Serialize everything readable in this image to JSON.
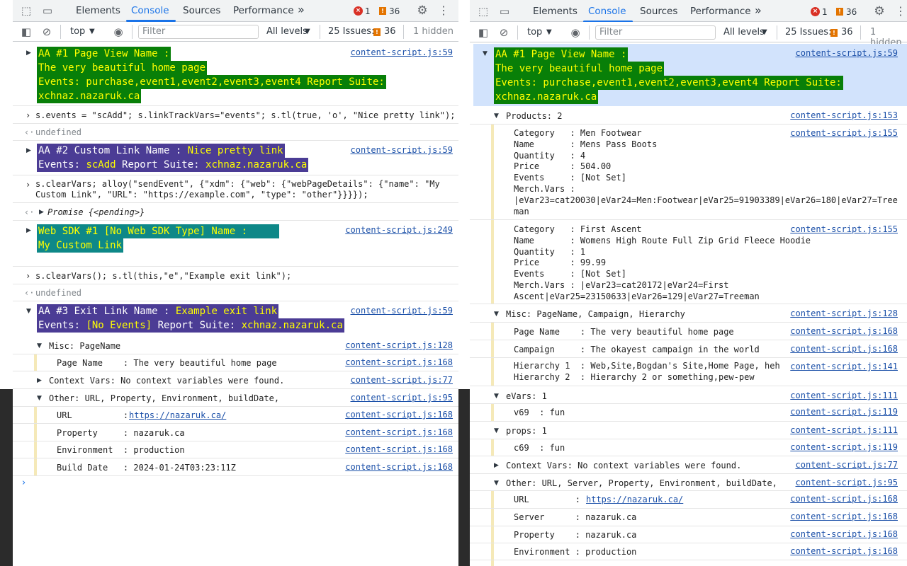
{
  "tabs": {
    "elements": "Elements",
    "console": "Console",
    "sources": "Sources",
    "performance": "Performance",
    "more": "»"
  },
  "status": {
    "errors": "1",
    "warnings": "36"
  },
  "toolbar": {
    "context": "top",
    "filter_placeholder": "Filter",
    "levels": "All levels",
    "issues_label": "25 Issues:",
    "issues_count": "36",
    "hidden": "1 hidden"
  },
  "left": {
    "aa1": {
      "l1": "AA #1 Page View Name :",
      "l2": "The very beautiful home page",
      "l3": "Events: purchase,event1,event2,event3,event4 Report Suite:",
      "l4": "xchnaz.nazaruk.ca",
      "src": "content-script.js:59"
    },
    "cmd1": "s.events = \"scAdd\"; s.linkTrackVars=\"events\"; s.tl(true, 'o', \"Nice pretty link\");",
    "undef1": "undefined",
    "aa2": {
      "l1a": "AA #2 Custom Link Name : ",
      "l1b": "Nice pretty link",
      "l2a": "Events: ",
      "l2b": "scAdd",
      "l2c": " Report Suite: ",
      "l2d": "xchnaz.nazaruk.ca",
      "src": "content-script.js:59"
    },
    "cmd2a": "s.clearVars; alloy(\"sendEvent\", {\"xdm\": {\"web\": {\"webPageDetails\": {\"name\": \"My",
    "cmd2b": "Custom Link\", \"URL\": \"https://example.com\", \"type\": \"other\"}}}});",
    "promise": "Promise {<pending>}",
    "sdk": {
      "l1": "Web SDK #1 [No Web SDK Type] Name :",
      "l2": "My Custom Link",
      "src": "content-script.js:249"
    },
    "cmd3": "s.clearVars(); s.tl(this,\"e\",\"Example exit link\");",
    "undef2": "undefined",
    "aa3": {
      "l1a": "AA #3 Exit Link Name : ",
      "l1b": "Example exit link",
      "l2a": "Events: ",
      "l2b": "[No Events]",
      "l2c": " Report Suite: ",
      "l2d": "xchnaz.nazaruk.ca",
      "src": "content-script.js:59"
    },
    "misc": {
      "title": "Misc: PageName",
      "src": "content-script.js:128",
      "row": "Page Name    : The very beautiful home page",
      "row_src": "content-script.js:168"
    },
    "ctx": {
      "title": "Context Vars: No context variables were found.",
      "src": "content-script.js:77"
    },
    "other": {
      "title": "Other: URL, Property, Environment, buildDate,",
      "src": "content-script.js:95",
      "url_label": "URL          : ",
      "url": "https://nazaruk.ca/",
      "property": "Property     : nazaruk.ca",
      "environment": "Environment  : production",
      "build": "Build Date   : 2024-01-24T03:23:11Z",
      "row_src": "content-script.js:168"
    },
    "prompt": "›"
  },
  "right": {
    "aa1": {
      "l1": "AA #1 Page View Name :",
      "l2": "The very beautiful home page",
      "l3": "Events: purchase,event1,event2,event3,event4 Report Suite:",
      "l4": "xchnaz.nazaruk.ca",
      "src": "content-script.js:59"
    },
    "products": {
      "title": "Products: 2",
      "src": "content-script.js:153",
      "item_src": "content-script.js:155",
      "p1": [
        "Category   : Men Footwear",
        "Name       : Mens Pass Boots",
        "Quantity   : 4",
        "Price      : 504.00",
        "Events     : [Not Set]",
        "Merch.Vars :",
        "|eVar23=cat20030|eVar24=Men:Footwear|eVar25=91903389|eVar26=180|eVar27=Tree",
        "man"
      ],
      "p2": [
        "Category   : First Ascent",
        "Name       : Womens High Route Full Zip Grid Fleece Hoodie",
        "Quantity   : 1",
        "Price      : 99.99",
        "Events     : [Not Set]",
        "Merch.Vars : |eVar23=cat20172|eVar24=First",
        "Ascent|eVar25=23150633|eVar26=129|eVar27=Treeman"
      ]
    },
    "misc": {
      "title": "Misc: PageName, Campaign, Hierarchy",
      "src": "content-script.js:128",
      "pagename": "Page Name    : The very beautiful home page",
      "pagename_src": "content-script.js:168",
      "campaign": "Campaign     : The okayest campaign in the world",
      "campaign_src": "content-script.js:168",
      "h1": "Hierarchy 1  : Web,Site,Bogdan's Site,Home Page, heh",
      "h2": "Hierarchy 2  : Hierarchy 2 or something,pew-pew",
      "h_src": "content-script.js:141"
    },
    "evars": {
      "title": "eVars: 1",
      "src": "content-script.js:111",
      "row": "v69  : fun",
      "row_src": "content-script.js:119"
    },
    "props": {
      "title": "props: 1",
      "src": "content-script.js:111",
      "row": "c69  : fun",
      "row_src": "content-script.js:119"
    },
    "ctx": {
      "title": "Context Vars: No context variables were found.",
      "src": "content-script.js:77"
    },
    "other": {
      "title": "Other: URL, Server, Property, Environment, buildDate,",
      "src": "content-script.js:95",
      "url_label": "URL         : ",
      "url": "https://nazaruk.ca/",
      "server": "Server      : nazaruk.ca",
      "property": "Property    : nazaruk.ca",
      "environment": "Environment : production",
      "row_src": "content-script.js:168"
    }
  }
}
